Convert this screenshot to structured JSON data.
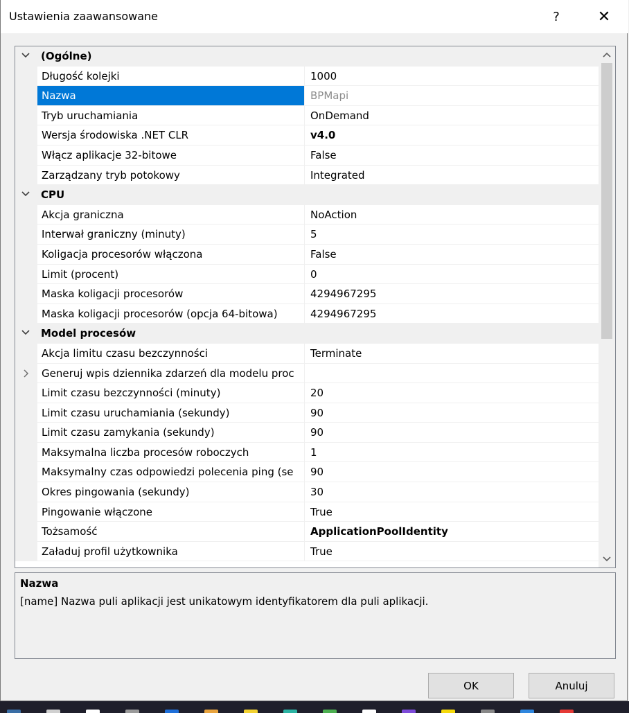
{
  "window": {
    "title": "Ustawienia zaawansowane",
    "help_label": "?",
    "close_label": "✕"
  },
  "colors": {
    "selection": "#0078d7",
    "category_bg": "#f0f0f0"
  },
  "rows": [
    {
      "type": "category",
      "label": "(Ogólne)",
      "expanded": true
    },
    {
      "type": "prop",
      "name": "Długość kolejki",
      "value": "1000"
    },
    {
      "type": "prop",
      "name": "Nazwa",
      "value": "BPMapi",
      "selected": true,
      "dim": true
    },
    {
      "type": "prop",
      "name": "Tryb uruchamiania",
      "value": "OnDemand"
    },
    {
      "type": "prop",
      "name": "Wersja środowiska .NET CLR",
      "value": "v4.0",
      "bold": true
    },
    {
      "type": "prop",
      "name": "Włącz aplikacje 32-bitowe",
      "value": "False"
    },
    {
      "type": "prop",
      "name": "Zarządzany tryb potokowy",
      "value": "Integrated"
    },
    {
      "type": "category",
      "label": "CPU",
      "expanded": true
    },
    {
      "type": "prop",
      "name": "Akcja graniczna",
      "value": "NoAction"
    },
    {
      "type": "prop",
      "name": "Interwał graniczny (minuty)",
      "value": "5"
    },
    {
      "type": "prop",
      "name": "Koligacja procesorów włączona",
      "value": "False"
    },
    {
      "type": "prop",
      "name": "Limit (procent)",
      "value": "0"
    },
    {
      "type": "prop",
      "name": "Maska koligacji procesorów",
      "value": "4294967295"
    },
    {
      "type": "prop",
      "name": "Maska koligacji procesorów (opcja 64-bitowa)",
      "value": "4294967295"
    },
    {
      "type": "category",
      "label": "Model procesów",
      "expanded": true
    },
    {
      "type": "prop",
      "name": "Akcja limitu czasu bezczynności",
      "value": "Terminate"
    },
    {
      "type": "prop",
      "name": "Generuj wpis dziennika zdarzeń dla modelu proc",
      "value": "",
      "expandable": true
    },
    {
      "type": "prop",
      "name": "Limit czasu bezczynności (minuty)",
      "value": "20"
    },
    {
      "type": "prop",
      "name": "Limit czasu uruchamiania (sekundy)",
      "value": "90"
    },
    {
      "type": "prop",
      "name": "Limit czasu zamykania (sekundy)",
      "value": "90"
    },
    {
      "type": "prop",
      "name": "Maksymalna liczba procesów roboczych",
      "value": "1"
    },
    {
      "type": "prop",
      "name": "Maksymalny czas odpowiedzi polecenia ping (se",
      "value": "90"
    },
    {
      "type": "prop",
      "name": "Okres pingowania (sekundy)",
      "value": "30"
    },
    {
      "type": "prop",
      "name": "Pingowanie włączone",
      "value": "True"
    },
    {
      "type": "prop",
      "name": "Tożsamość",
      "value": "ApplicationPoolIdentity",
      "bold": true
    },
    {
      "type": "prop",
      "name": "Załaduj profil użytkownika",
      "value": "True"
    }
  ],
  "description": {
    "title": "Nazwa",
    "text": "[name] Nazwa puli aplikacji jest unikatowym identyfikatorem dla puli aplikacji."
  },
  "buttons": {
    "ok": "OK",
    "cancel": "Anuluj"
  },
  "taskbar": {
    "icon_colors": [
      "#3a6ea5",
      "#d0d0d0",
      "#ffffff",
      "#9a9a9a",
      "#1e6fd9",
      "#e8a33d",
      "#f2d130",
      "#2bb3a3",
      "#4caf50",
      "#ffffff",
      "#7d4bd9",
      "#f5d90a",
      "#888888",
      "#2e86de",
      "#e53935"
    ]
  }
}
